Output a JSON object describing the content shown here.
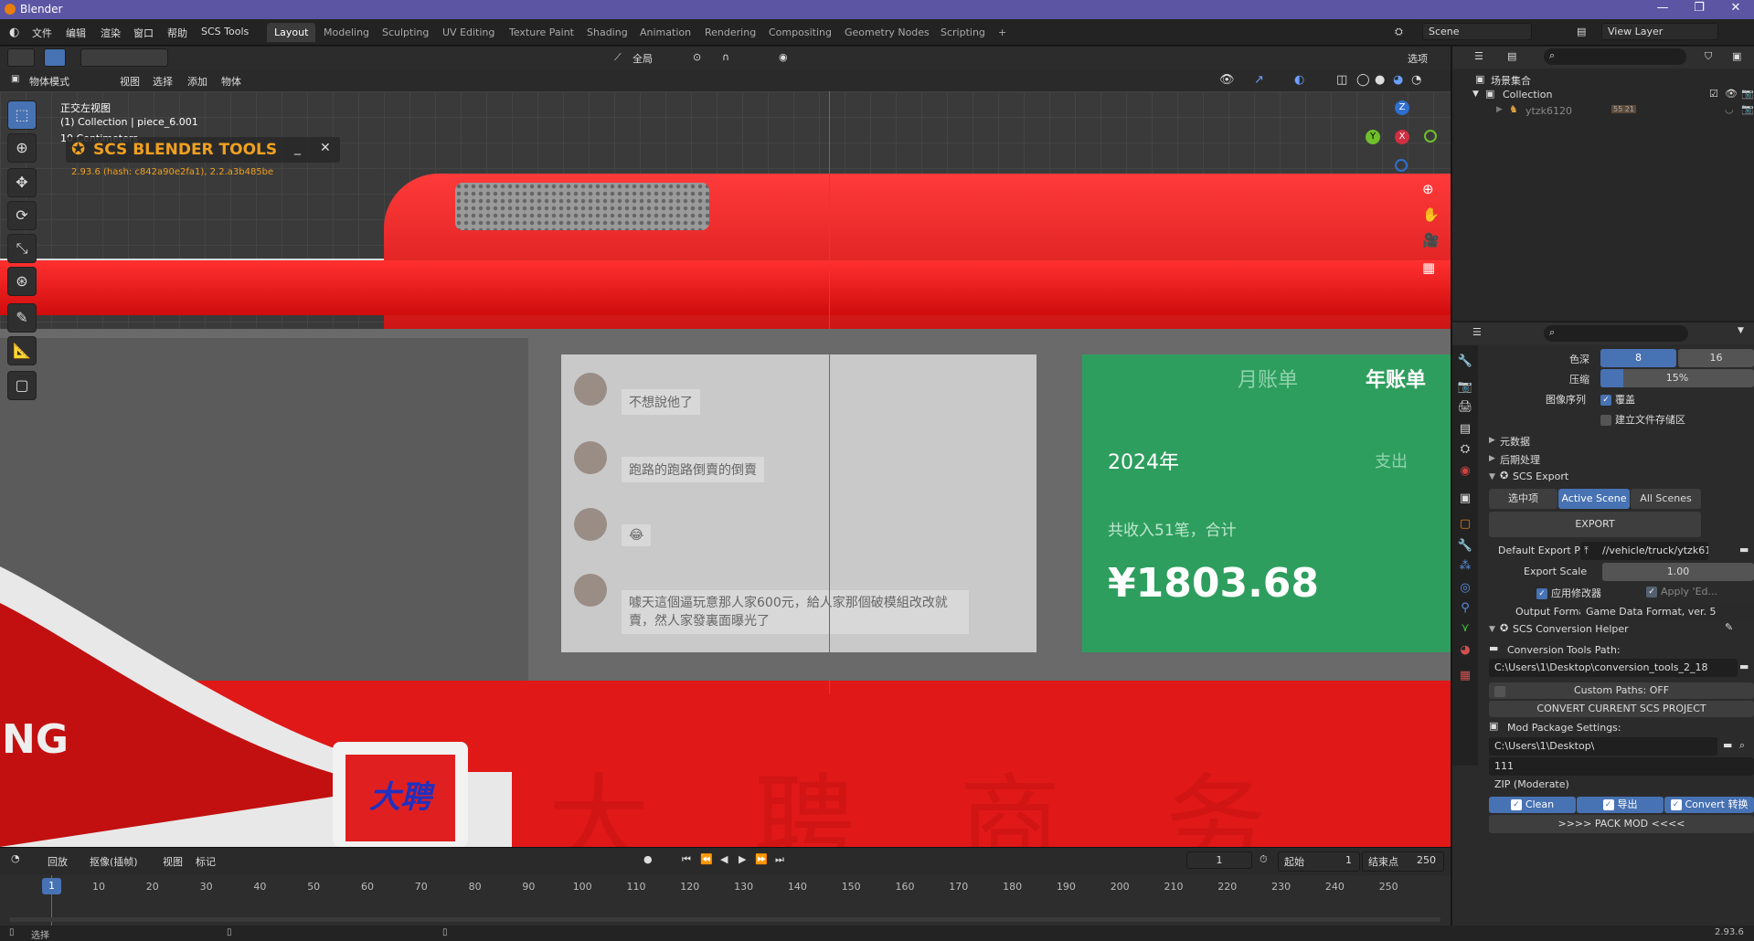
{
  "window": {
    "title": "Blender",
    "minimize": "—",
    "maximize": "❐",
    "close": "✕"
  },
  "menu": [
    "文件",
    "编辑",
    "渲染",
    "窗口",
    "帮助",
    "SCS Tools"
  ],
  "workspaces": [
    "Layout",
    "Modeling",
    "Sculpting",
    "UV Editing",
    "Texture Paint",
    "Shading",
    "Animation",
    "Rendering",
    "Compositing",
    "Geometry Nodes",
    "Scripting"
  ],
  "scene": {
    "name": "Scene",
    "view_layer": "View Layer"
  },
  "viewport_header": {
    "transform": "全局",
    "options": "选项",
    "mode": "物体模式",
    "menus": [
      "视图",
      "选择",
      "添加",
      "物体"
    ]
  },
  "viewport": {
    "view_name": "正交左视图",
    "collection_info": "(1) Collection | piece_6.001",
    "scale": "10 Centimeters",
    "axes": {
      "x": "X",
      "y": "Y",
      "z": "Z"
    }
  },
  "scs_panel": {
    "title": "SCS BLENDER TOOLS",
    "version": "2.93.6 (hash: c842a90e2fa1), 2.2.a3b485be"
  },
  "scene_content": {
    "chat_lines": [
      "不想說他了",
      "跑路的跑路倒賣的倒賣",
      "😂",
      "噱天這個逼玩意那人家600元，給人家那個破模組改改就賣，然人家發裏面曝光了"
    ],
    "finance_tabs": [
      "月账单",
      "年账单"
    ],
    "year": "2024年",
    "expense_tab": "支出",
    "income_summary": "共收入51笔，合计",
    "amount": "¥1803.68",
    "logo_text": "大聘",
    "big_text": "大 聘 商 务",
    "brand_fragment": "NG"
  },
  "outliner": {
    "root": "场景集合",
    "collection": "Collection",
    "object": "ytzk6120",
    "object_badge": "55 21"
  },
  "properties": {
    "color_depth_label": "色深",
    "color_depth_options": [
      "8",
      "16"
    ],
    "compression_label": "压缩",
    "compression_value": "15%",
    "compression_fraction": 0.15,
    "image_sequence_label": "图像序列",
    "overwrite_label": "覆盖",
    "placeholders_label": "建立文件存储区",
    "metadata_label": "元数据",
    "postprocess_label": "后期处理",
    "scs_export": {
      "title": "SCS Export",
      "scope_options": [
        "选中项",
        "Active Scene",
        "All Scenes"
      ],
      "export_button": "EXPORT",
      "default_path_label": "Default Export Path",
      "default_path_value": "//vehicle/truck/ytzk61...",
      "export_scale_label": "Export Scale",
      "export_scale_value": "1.00",
      "apply_modifiers_label": "应用修改器",
      "apply_edit_label": "Apply 'Ed...",
      "output_format_label": "Output Format",
      "output_format_value": "Game Data Format, ver. 5"
    },
    "conversion": {
      "title": "SCS Conversion Helper",
      "tools_path_label": "Conversion Tools Path:",
      "tools_path_value": "C:\\Users\\1\\Desktop\\conversion_tools_2_18",
      "custom_paths": "Custom Paths: OFF",
      "convert_button": "CONVERT CURRENT SCS PROJECT",
      "mod_package_label": "Mod Package Settings:",
      "mod_path": "C:\\Users\\1\\Desktop\\",
      "mod_name": "111",
      "compression": "ZIP (Moderate)",
      "clean_label": "Clean",
      "export_label": "导出",
      "convert_label": "Convert 转换",
      "pack_button": ">>>>  PACK MOD  <<<<"
    }
  },
  "timeline": {
    "menus": [
      "回放",
      "抠像(插帧)",
      "视图",
      "标记"
    ],
    "current_frame": "1",
    "start_label": "起始",
    "start_value": "1",
    "end_label": "结束点",
    "end_value": "250",
    "ticks": [
      "1",
      "10",
      "20",
      "30",
      "40",
      "50",
      "60",
      "70",
      "80",
      "90",
      "100",
      "110",
      "120",
      "130",
      "140",
      "150",
      "160",
      "170",
      "180",
      "190",
      "200",
      "210",
      "220",
      "230",
      "240",
      "250"
    ]
  },
  "status": {
    "left": "选择",
    "version": "2.93.6"
  },
  "colors": {
    "title_bar": "#5b55a3",
    "accent": "#4772b3",
    "bus_red": "#e01818",
    "finance_green": "#2e9e5e"
  }
}
